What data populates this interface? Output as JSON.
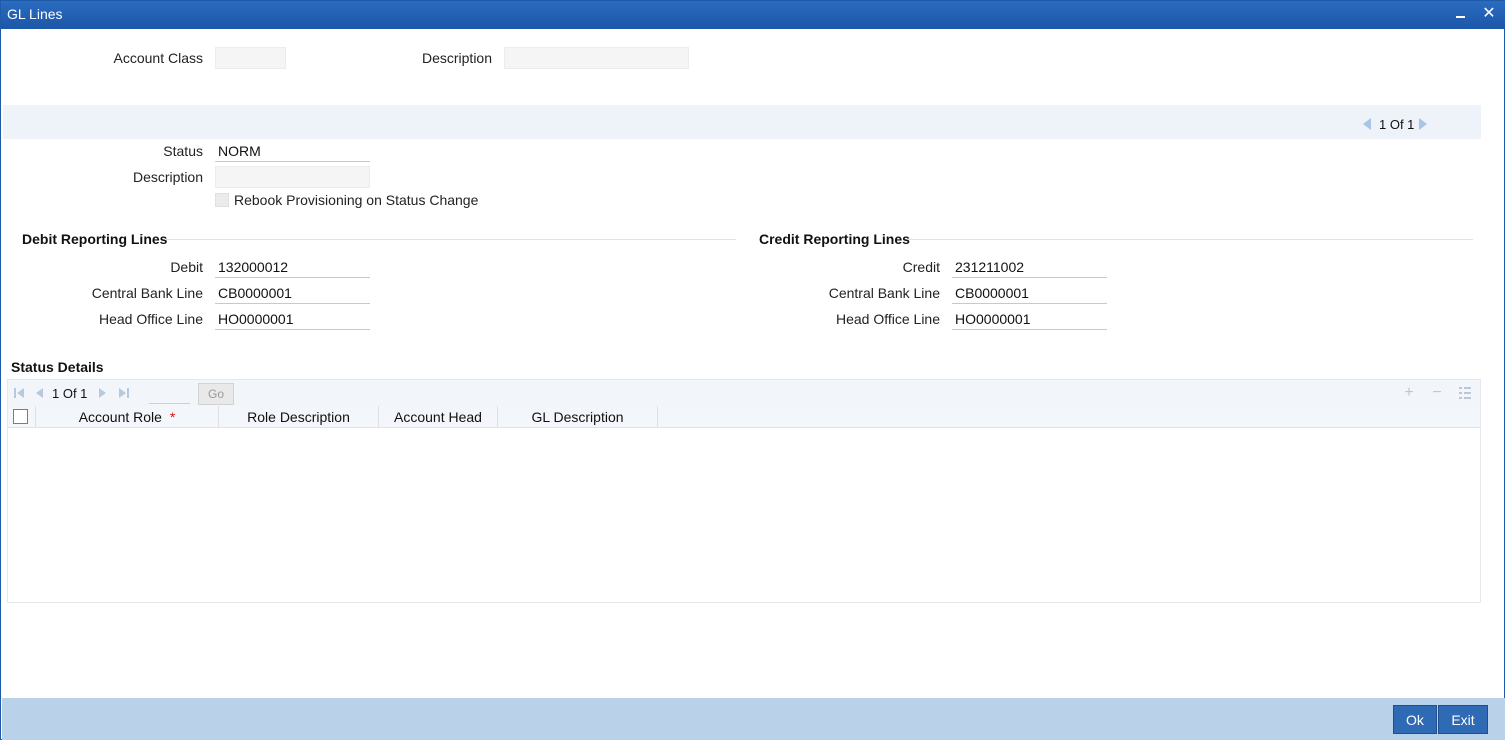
{
  "window": {
    "title": "GL Lines",
    "minimize_icon": "minimize-icon",
    "close_icon": "close-icon",
    "close_glyph": "✕"
  },
  "header": {
    "account_class_label": "Account Class",
    "account_class_value": "",
    "description_label": "Description",
    "description_value": ""
  },
  "status_pager": {
    "text": "1 Of 1"
  },
  "status": {
    "status_label": "Status",
    "status_value": "NORM",
    "description_label": "Description",
    "description_value": "",
    "rebook_label": "Rebook Provisioning on Status Change",
    "rebook_checked": false
  },
  "debit": {
    "title": "Debit Reporting Lines",
    "debit_label": "Debit",
    "debit_value": "132000012",
    "cb_label": "Central Bank Line",
    "cb_value": "CB0000001",
    "ho_label": "Head Office Line",
    "ho_value": "HO0000001"
  },
  "credit": {
    "title": "Credit Reporting Lines",
    "credit_label": "Credit",
    "credit_value": "231211002",
    "cb_label": "Central Bank Line",
    "cb_value": "CB0000001",
    "ho_label": "Head Office Line",
    "ho_value": "HO0000001"
  },
  "status_details": {
    "title": "Status Details",
    "pager_text": "1 Of 1",
    "go_label": "Go",
    "columns": [
      "Account Role",
      "Role Description",
      "Account Head",
      "GL Description"
    ],
    "required_mark": "*",
    "rows": []
  },
  "footer": {
    "ok_label": "Ok",
    "exit_label": "Exit"
  },
  "colors": {
    "title_bar": "#1c56a8",
    "footer": "#b9d2ea",
    "button": "#2f6ab5",
    "required": "#d11"
  }
}
